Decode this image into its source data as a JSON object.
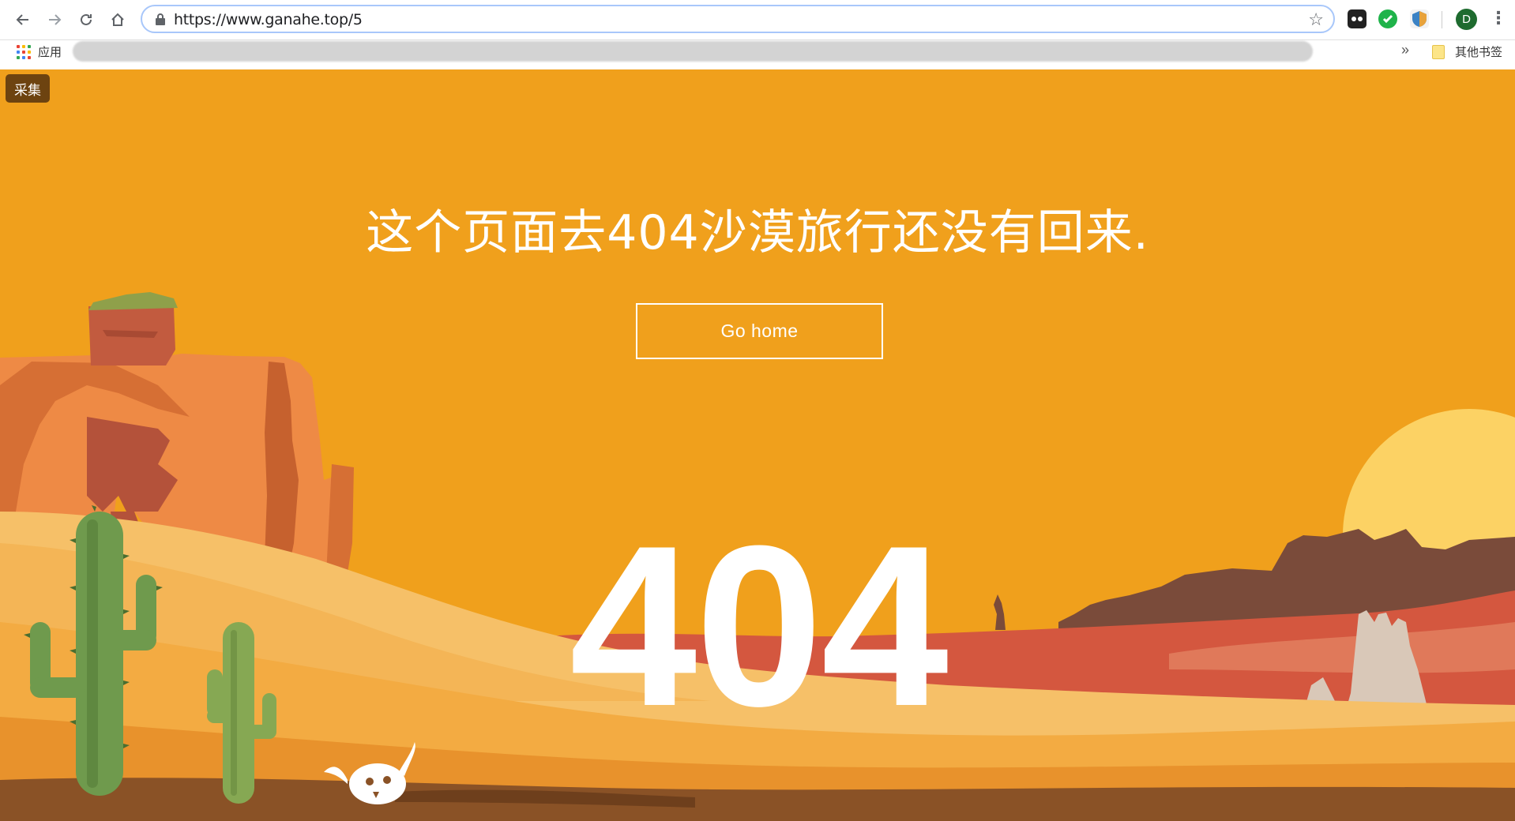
{
  "browser": {
    "url": "https://www.ganahe.top/5",
    "apps_label": "应用",
    "other_bookmarks": "其他书签",
    "profile_initial": "D",
    "overflow_chevron": "»"
  },
  "page": {
    "collect_label": "采集",
    "headline": "这个页面去404沙漠旅行还没有回来.",
    "go_home_label": "Go home",
    "error_code": "404"
  },
  "colors": {
    "sky": "#f0a01c",
    "button_dark": "#6d4310",
    "sun": "#fcd264",
    "cactus": "#6f9a4d"
  },
  "icons": [
    "back-arrow-icon",
    "forward-arrow-icon",
    "reload-icon",
    "home-icon",
    "lock-icon",
    "bookmark-star-icon",
    "apps-grid-icon",
    "folder-icon",
    "menu-dots-icon"
  ]
}
